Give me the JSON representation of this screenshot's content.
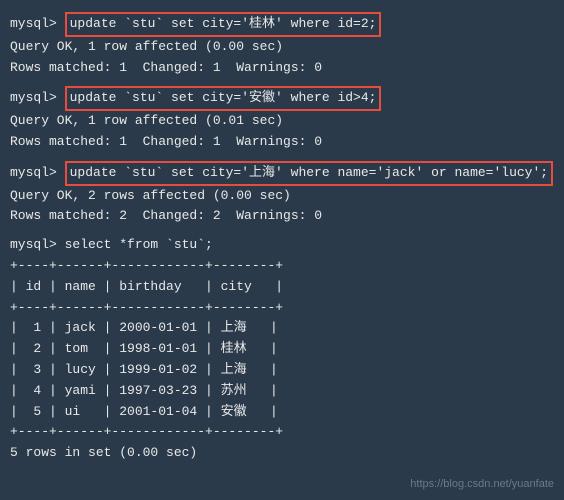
{
  "prompt": "mysql> ",
  "commands": {
    "cmd1": "update `stu` set city='桂林' where id=2;",
    "cmd2": "update `stu` set city='安徽' where id>4;",
    "cmd3": "update `stu` set city='上海' where name='jack' or name='lucy';",
    "cmd4": "select *from `stu`;"
  },
  "results": {
    "ok1": "Query OK, 1 row affected (0.00 sec)",
    "match1": "Rows matched: 1  Changed: 1  Warnings: 0",
    "ok2": "Query OK, 1 row affected (0.01 sec)",
    "match2": "Rows matched: 1  Changed: 1  Warnings: 0",
    "ok3": "Query OK, 2 rows affected (0.00 sec)",
    "match3": "Rows matched: 2  Changed: 2  Warnings: 0",
    "rowcount": "5 rows in set (0.00 sec)"
  },
  "table": {
    "sep": "+----+------+------------+--------+",
    "header": "| id | name | birthday   | city   |",
    "rows": [
      "|  1 | jack | 2000-01-01 | 上海   |",
      "|  2 | tom  | 1998-01-01 | 桂林   |",
      "|  3 | lucy | 1999-01-02 | 上海   |",
      "|  4 | yami | 1997-03-23 | 苏州   |",
      "|  5 | ui   | 2001-01-04 | 安徽   |"
    ]
  },
  "watermark": "https://blog.csdn.net/yuanfate"
}
